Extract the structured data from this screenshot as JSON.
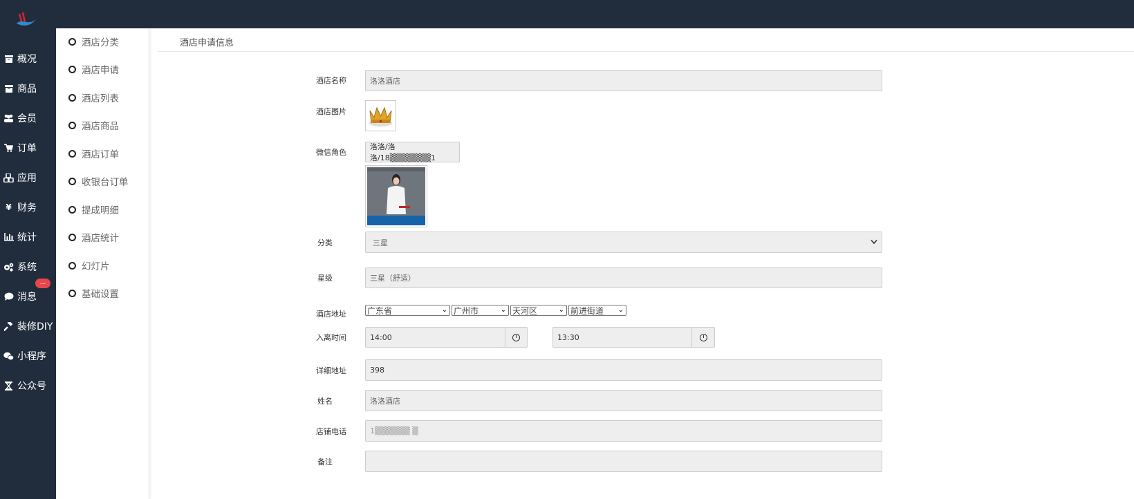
{
  "nav": {
    "items": [
      {
        "icon": "archive-icon",
        "label": "概况"
      },
      {
        "icon": "archive-icon",
        "label": "商品"
      },
      {
        "icon": "users-icon",
        "label": "会员"
      },
      {
        "icon": "cart-icon",
        "label": "订单"
      },
      {
        "icon": "cubes-icon",
        "label": "应用"
      },
      {
        "icon": "yen-icon",
        "label": "财务"
      },
      {
        "icon": "bar-chart-icon",
        "label": "统计"
      },
      {
        "icon": "gears-icon",
        "label": "系统"
      },
      {
        "icon": "comment-icon",
        "label": "消息",
        "badge": "..."
      },
      {
        "icon": "gavel-icon",
        "label": "装修DIY"
      },
      {
        "icon": "wechat-icon",
        "label": "小程序"
      },
      {
        "icon": "hourglass-icon",
        "label": "公众号"
      }
    ]
  },
  "subnav": {
    "items": [
      "酒店分类",
      "酒店申请",
      "酒店列表",
      "酒店商品",
      "酒店订单",
      "收银台订单",
      "提成明细",
      "酒店统计",
      "幻灯片",
      "基础设置"
    ]
  },
  "panel": {
    "title": "酒店申请信息"
  },
  "form": {
    "name": {
      "label": "酒店名称",
      "value": "洛洛酒店"
    },
    "image": {
      "label": "酒店图片"
    },
    "wechat": {
      "label": "微信角色",
      "value": "洛洛/洛洛/18▒▒▒▒▒▒▒1"
    },
    "category": {
      "label": "分类",
      "value": "三星"
    },
    "star": {
      "label": "星级",
      "value": "三星（舒适）"
    },
    "address": {
      "label": "酒店地址",
      "province": "广东省",
      "city": "广州市",
      "district": "天河区",
      "street": "前进街道"
    },
    "time": {
      "label": "入离时间",
      "checkin": "14:00",
      "checkout": "13:30"
    },
    "detail": {
      "label": "详细地址",
      "value": "398"
    },
    "contact": {
      "label": "姓名",
      "value": "洛洛酒店"
    },
    "phone": {
      "label": "店铺电话",
      "value": "1▒▒▒▒▒▒ ▒"
    },
    "note": {
      "label": "备注",
      "value": ""
    }
  },
  "colors": {
    "nav_bg": "#212d3d",
    "badge": "#e5474b",
    "field_bg": "#eeeeee"
  }
}
